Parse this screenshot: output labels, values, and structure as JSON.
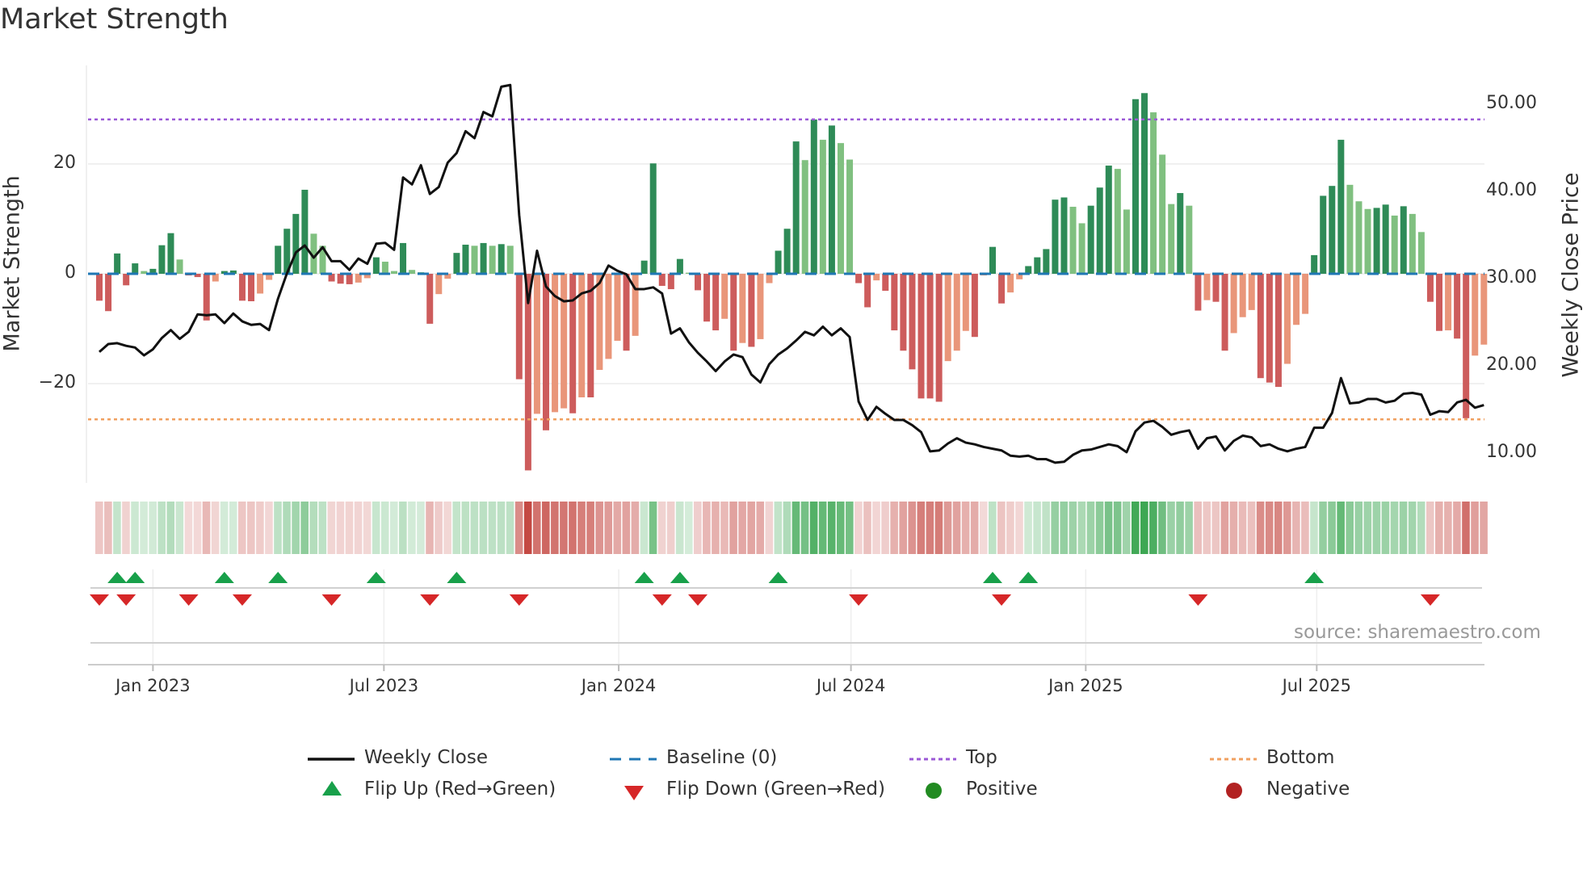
{
  "title": "Market Strength",
  "source": "source: sharemaestro.com",
  "colors": {
    "strong_green": "#2e8b57",
    "light_green": "#80c080",
    "strong_red": "#cd5c5c",
    "light_red": "#e9967a",
    "close_line": "#111111",
    "baseline": "#1f77b4",
    "top": "#9b59d6",
    "bottom": "#f0a060",
    "flip_up": "#18a04a",
    "flip_down": "#d62728",
    "positive": "#228b22",
    "negative": "#b22222"
  },
  "legend": [
    {
      "label": "Weekly Close",
      "icon": "solid-line"
    },
    {
      "label": "Baseline (0)",
      "icon": "dashed-line"
    },
    {
      "label": "Top",
      "icon": "dotted-line"
    },
    {
      "label": "Bottom",
      "icon": "dotted-line"
    },
    {
      "label": "Flip Up (Red→Green)",
      "icon": "triangle-up"
    },
    {
      "label": "Flip Down (Green→Red)",
      "icon": "triangle-down"
    },
    {
      "label": "Positive",
      "icon": "circle"
    },
    {
      "label": "Negative",
      "icon": "circle"
    }
  ],
  "chart_data": {
    "type": "bar",
    "title": "Market Strength",
    "ylabel": "Market Strength",
    "y2label": "Weekly Close Price",
    "start_week": "2022-11-20",
    "interval": "weekly",
    "ylim": [
      -38,
      40
    ],
    "y2lim": [
      7,
      51.9
    ],
    "yticks": [
      {
        "v": 20,
        "label": "20"
      },
      {
        "v": 0,
        "label": "0"
      },
      {
        "v": -20,
        "label": "−20"
      }
    ],
    "y2ticks": [
      {
        "v": 50,
        "label": "50.00"
      },
      {
        "v": 40,
        "label": "40.00"
      },
      {
        "v": 30,
        "label": "30.00"
      },
      {
        "v": 20,
        "label": "20.00"
      },
      {
        "v": 10,
        "label": "10.00"
      }
    ],
    "xticks": [
      {
        "date": "2023-01-01",
        "label": "Jan 2023"
      },
      {
        "date": "2023-07-01",
        "label": "Jul 2023"
      },
      {
        "date": "2024-01-01",
        "label": "Jan 2024"
      },
      {
        "date": "2024-07-01",
        "label": "Jul 2024"
      },
      {
        "date": "2025-01-01",
        "label": "Jan 2025"
      },
      {
        "date": "2025-07-01",
        "label": "Jul 2025"
      }
    ],
    "top_level": 28.1,
    "bottom_level": -26.5,
    "baseline": 0,
    "strength": [
      -4.9,
      -6.8,
      3.7,
      -2.1,
      1.9,
      0.5,
      0.9,
      5.2,
      7.4,
      2.6,
      -0.3,
      -0.6,
      -8.5,
      -1.4,
      0.5,
      0.6,
      -4.9,
      -5.0,
      -3.6,
      -1.1,
      5.1,
      8.2,
      10.9,
      15.3,
      7.3,
      5.1,
      -1.4,
      -1.8,
      -1.9,
      -1.6,
      -0.8,
      3.0,
      2.2,
      0.5,
      5.6,
      0.7,
      0.3,
      -9.1,
      -3.7,
      -0.9,
      3.8,
      5.3,
      5.1,
      5.6,
      5.1,
      5.4,
      5.1,
      -19.2,
      -35.8,
      -25.5,
      -28.5,
      -25.2,
      -24.5,
      -25.4,
      -22.5,
      -22.5,
      -17.5,
      -15.5,
      -12.2,
      -14.0,
      -11.3,
      2.4,
      20.1,
      -2.2,
      -2.8,
      2.7,
      0.2,
      -3.0,
      -8.7,
      -10.3,
      -8.2,
      -14.0,
      -12.6,
      -13.3,
      -11.9,
      -1.7,
      4.2,
      8.2,
      24.1,
      20.7,
      28.1,
      24.4,
      27.0,
      23.8,
      20.8,
      -1.7,
      -6.1,
      -1.2,
      -3.1,
      -10.3,
      -14.0,
      -17.4,
      -22.7,
      -22.7,
      -23.3,
      -15.9,
      -14.0,
      -10.4,
      -11.5,
      -0.3,
      4.9,
      -5.4,
      -3.4,
      -1.0,
      1.4,
      3.0,
      4.5,
      13.5,
      13.9,
      12.2,
      9.2,
      12.4,
      15.7,
      19.7,
      19.1,
      11.7,
      31.8,
      32.9,
      29.4,
      21.7,
      12.7,
      14.7,
      12.4,
      -6.7,
      -4.8,
      -5.1,
      -14.0,
      -10.8,
      -7.9,
      -6.6,
      -19.0,
      -19.8,
      -20.6,
      -16.4,
      -9.3,
      -7.3,
      3.4,
      14.2,
      16.0,
      24.4,
      16.2,
      13.2,
      11.8,
      12.0,
      12.6,
      10.6,
      12.3,
      10.9,
      7.6,
      -5.1,
      -10.4,
      -10.3,
      -11.8,
      -26.3,
      -14.9,
      -12.9
    ],
    "close": [
      21.6,
      22.5,
      22.6,
      22.3,
      22.1,
      21.2,
      21.9,
      23.2,
      24.1,
      23.1,
      23.9,
      25.9,
      25.8,
      25.9,
      24.9,
      26.0,
      25.1,
      24.7,
      24.8,
      24.1,
      27.7,
      30.6,
      33.0,
      33.8,
      32.4,
      33.6,
      32.0,
      32.0,
      31.0,
      32.3,
      31.7,
      34.0,
      34.1,
      33.3,
      41.6,
      40.8,
      43.0,
      39.7,
      40.5,
      43.3,
      44.4,
      46.9,
      46.1,
      49.1,
      48.6,
      52.0,
      52.2,
      37.3,
      27.2,
      33.2,
      29.1,
      28.0,
      27.4,
      27.5,
      28.3,
      28.6,
      29.5,
      31.5,
      30.9,
      30.5,
      28.8,
      28.8,
      29.0,
      28.3,
      23.7,
      24.3,
      22.7,
      21.5,
      20.5,
      19.4,
      20.5,
      21.3,
      21.0,
      19.0,
      18.1,
      20.2,
      21.3,
      22.0,
      22.9,
      23.9,
      23.5,
      24.5,
      23.5,
      24.3,
      23.3,
      15.9,
      13.8,
      15.3,
      14.5,
      13.8,
      13.8,
      13.2,
      12.4,
      10.2,
      10.3,
      11.1,
      11.7,
      11.2,
      11.0,
      10.7,
      10.5,
      10.3,
      9.7,
      9.6,
      9.7,
      9.3,
      9.3,
      8.9,
      9.0,
      9.8,
      10.3,
      10.4,
      10.7,
      11.0,
      10.8,
      10.1,
      12.5,
      13.5,
      13.7,
      13.0,
      12.1,
      12.4,
      12.6,
      10.5,
      11.7,
      11.9,
      10.3,
      11.4,
      12.0,
      11.8,
      10.8,
      11.0,
      10.5,
      10.2,
      10.5,
      10.7,
      12.9,
      12.9,
      14.6,
      18.6,
      15.7,
      15.8,
      16.2,
      16.2,
      15.8,
      16.0,
      16.8,
      16.9,
      16.7,
      14.4,
      14.8,
      14.7,
      15.8,
      16.1,
      15.2,
      15.5
    ],
    "flip_up_weeks": [
      2,
      4,
      14,
      20,
      31,
      40,
      61,
      65,
      76,
      100,
      104,
      136
    ],
    "flip_down_weeks": [
      0,
      3,
      10,
      16,
      26,
      37,
      47,
      63,
      67,
      85,
      101,
      123,
      149
    ],
    "grid": true,
    "legend_position": "bottom"
  }
}
